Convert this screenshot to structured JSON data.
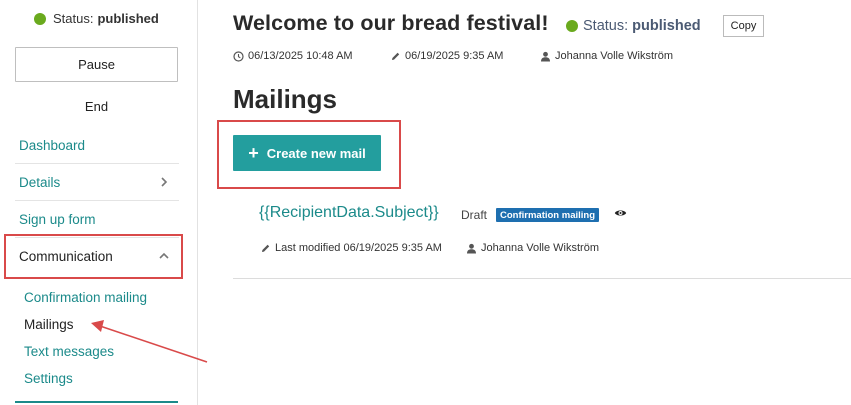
{
  "sidebar": {
    "status_label": "Status:",
    "status_value": "published",
    "pause_label": "Pause",
    "end_label": "End",
    "nav": [
      {
        "label": "Dashboard"
      },
      {
        "label": "Details"
      },
      {
        "label": "Sign up form"
      },
      {
        "label": "Communication"
      }
    ],
    "sub_items": [
      {
        "label": "Confirmation mailing"
      },
      {
        "label": "Mailings"
      },
      {
        "label": "Text messages"
      },
      {
        "label": "Settings"
      }
    ]
  },
  "header": {
    "title": "Welcome to our bread festival!",
    "status_label": "Status:",
    "status_value": "published",
    "copy_label": "Copy",
    "created": "06/13/2025 10:48 AM",
    "modified": "06/19/2025 9:35 AM",
    "author": "Johanna Volle Wikström"
  },
  "main": {
    "section_title": "Mailings",
    "create_label": "Create new mail",
    "mailing": {
      "subject": "{{RecipientData.Subject}}",
      "state": "Draft",
      "badge": "Confirmation mailing",
      "last_modified": "Last modified 06/19/2025 9:35 AM",
      "author": "Johanna Volle Wikström"
    }
  },
  "colors": {
    "accent": "#239e9e",
    "link": "#1b8a8a",
    "status_green": "#6aaa1e",
    "badge_blue": "#1e6fb0",
    "annotation_red": "#d94a4a"
  },
  "icons": {
    "clock": "clock-icon",
    "pencil": "pencil-icon",
    "user": "user-icon",
    "eye": "eye-icon",
    "chevron_right": "chevron-right-icon",
    "chevron_up": "chevron-up-icon",
    "plus": "plus-icon"
  }
}
